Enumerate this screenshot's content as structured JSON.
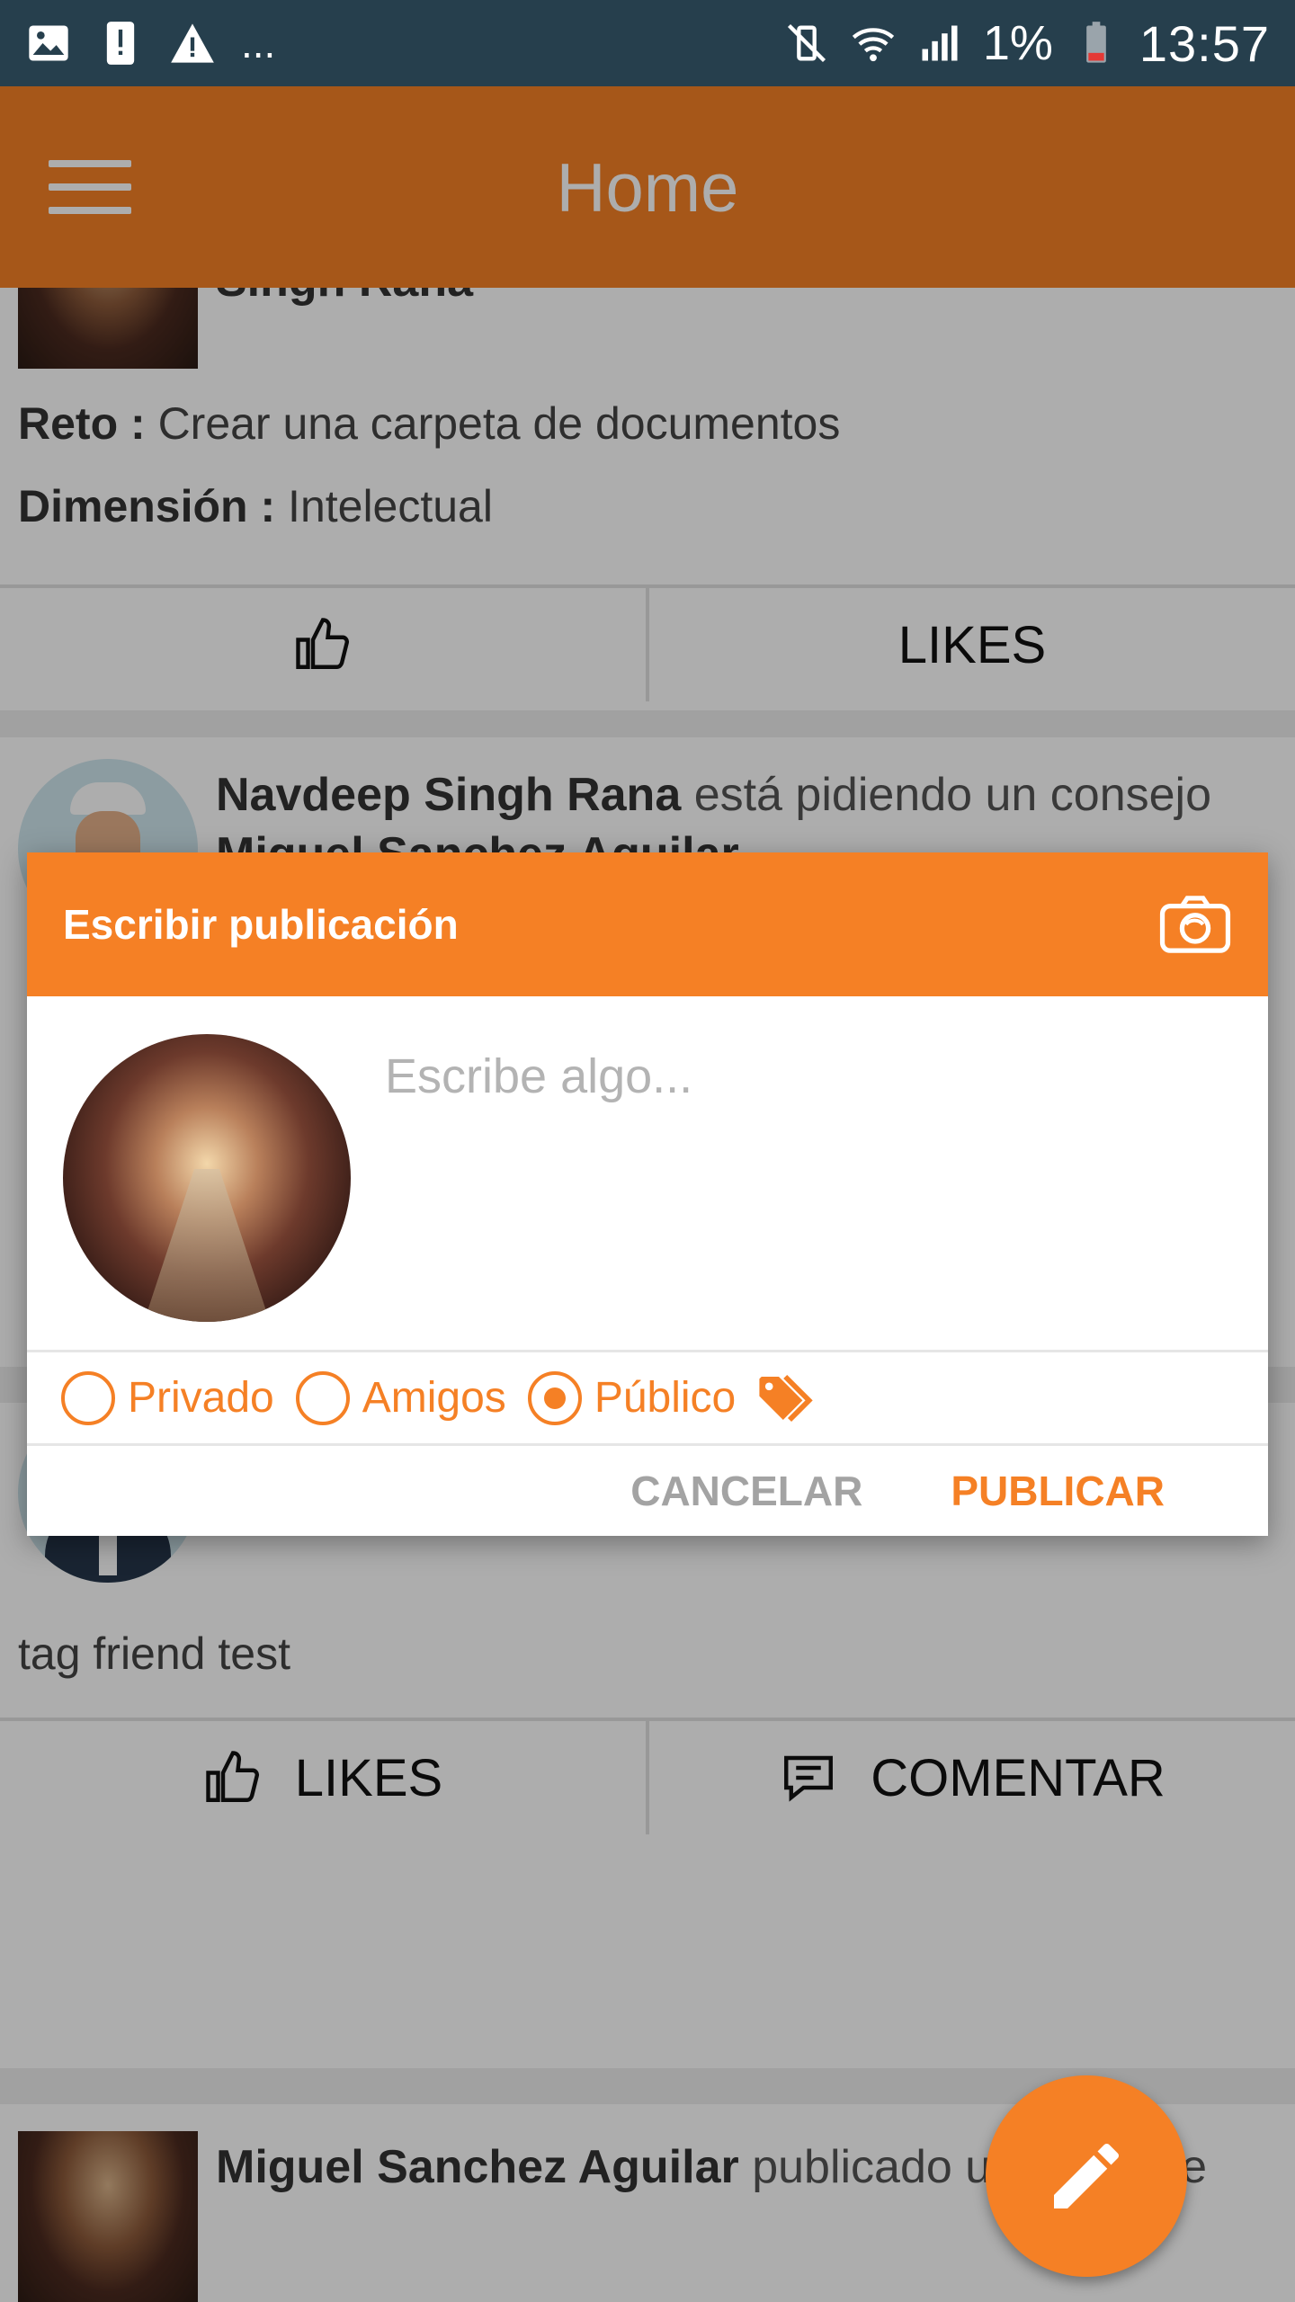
{
  "status_bar": {
    "battery": "1%",
    "time": "13:57",
    "left_overflow": "..."
  },
  "app_bar": {
    "title": "Home"
  },
  "feed": {
    "post1": {
      "author_partial": "Singh Rana",
      "challenge_label": "Reto :",
      "challenge_value": "Crear una carpeta de documentos",
      "dimension_label": "Dimensión :",
      "dimension_value": "Intelectual",
      "likes_label": "LIKES"
    },
    "post2": {
      "author": "Navdeep Singh Rana",
      "action": "está pidiendo un consejo",
      "target_partial": "Miguel Sanchez Aguilar"
    },
    "post3": {
      "text": "tag friend test",
      "likes_label": "LIKES",
      "comment_label": "COMENTAR"
    },
    "post4": {
      "author": "Miguel Sanchez Aguilar",
      "action": "publicado un mensaje"
    }
  },
  "dialog": {
    "title": "Escribir publicación",
    "input_placeholder": "Escribe algo...",
    "privacy_options": [
      "Privado",
      "Amigos",
      "Público"
    ],
    "selected_privacy": "Público",
    "cancel_label": "CANCELAR",
    "publish_label": "PUBLICAR"
  },
  "icons": {
    "fab": "pencil-icon",
    "camera": "camera-icon",
    "tag": "tag-icon"
  },
  "colors": {
    "accent": "#f58025",
    "status_bar": "#263f4d"
  }
}
